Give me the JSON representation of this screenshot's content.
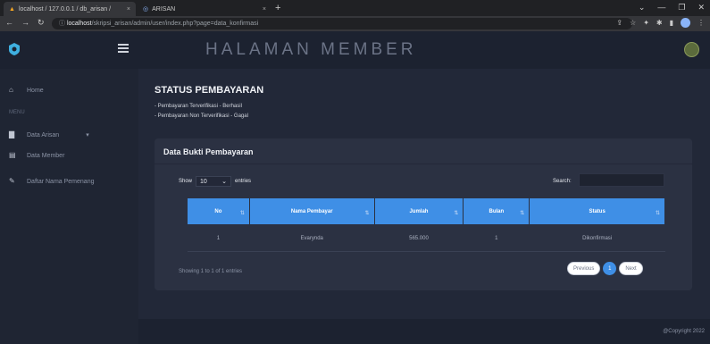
{
  "browser": {
    "tabs": [
      {
        "label": "localhost / 127.0.0.1 / db_arisan / ",
        "close": "×"
      },
      {
        "label": "ARISAN",
        "close": "×"
      }
    ],
    "new_tab": "+",
    "url_host": "localhost",
    "url_path": "/skripsi_arisan/admin/user/index.php?page=data_konfirmasi"
  },
  "topbar": {
    "heading": "HALAMAN MEMBER"
  },
  "sidebar": {
    "home": "Home",
    "menu_label": "MENU",
    "items": [
      {
        "label": "Data Arisan"
      },
      {
        "label": "Data Member"
      },
      {
        "label": "Daftar Nama Pemenang"
      }
    ]
  },
  "main": {
    "status_title": "STATUS PEMBAYARAN",
    "notes": [
      "- Pembayaran Terverifikasi - Berhasil",
      "- Pembayaran Non Terverifikasi - Gagal"
    ],
    "card_title": "Data Bukti Pembayaran",
    "show_label": "Show",
    "entries_value": "10",
    "entries_label": "entries",
    "search_label": "Search:",
    "columns": [
      "No",
      "Nama Pembayar",
      "Jumlah",
      "Bulan",
      "Status"
    ],
    "rows": [
      {
        "no": "1",
        "nama": "Evarynda",
        "jumlah": "565.000",
        "bulan": "1",
        "status": "Dikonfirmasi"
      }
    ],
    "info": "Showing 1 to 1 of 1 entries",
    "prev": "Previous",
    "page": "1",
    "next": "Next"
  },
  "footer": {
    "copyright": "@Copyright 2022"
  },
  "colors": {
    "accent": "#3f8fe6",
    "background": "#222838",
    "sidebar": "#1f2533"
  }
}
